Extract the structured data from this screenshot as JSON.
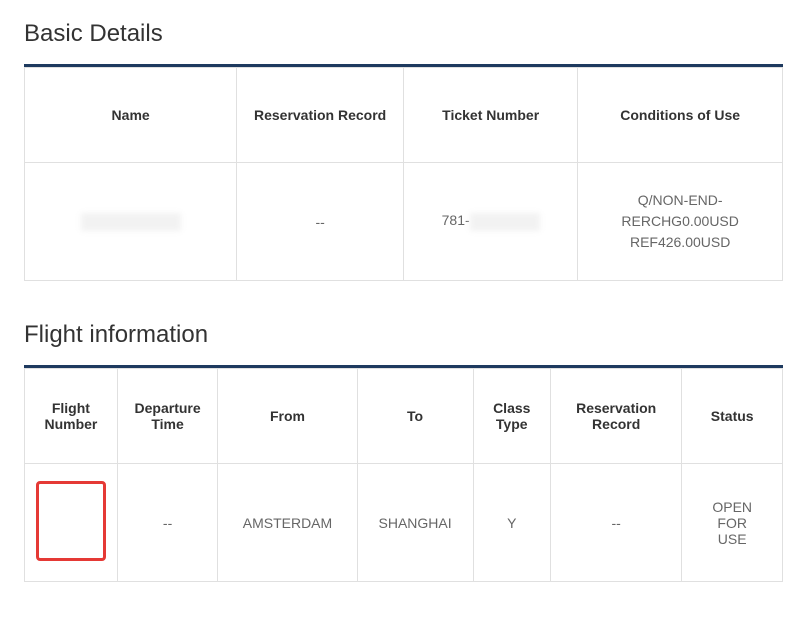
{
  "sections": {
    "basic_details_title": "Basic Details",
    "flight_info_title": "Flight information"
  },
  "basic_details": {
    "headers": {
      "name": "Name",
      "reservation_record": "Reservation Record",
      "ticket_number": "Ticket Number",
      "conditions": "Conditions of Use"
    },
    "row": {
      "name": "",
      "reservation_record": "--",
      "ticket_prefix": "781-",
      "ticket_suffix": "",
      "conditions_line1": "Q/NON-END-",
      "conditions_line2": "RERCHG0.00USD",
      "conditions_line3": "REF426.00USD"
    }
  },
  "flight_info": {
    "headers": {
      "flight_number": "Flight Number",
      "departure_time": "Departure Time",
      "from": "From",
      "to": "To",
      "class_type": "Class Type",
      "reservation_record": "Reservation Record",
      "status": "Status"
    },
    "row": {
      "flight_number": "",
      "departure_time": "--",
      "from": "AMSTERDAM",
      "to": "SHANGHAI",
      "class_type": "Y",
      "reservation_record": "--",
      "status_line1": "OPEN",
      "status_line2": "FOR",
      "status_line3": "USE"
    }
  }
}
